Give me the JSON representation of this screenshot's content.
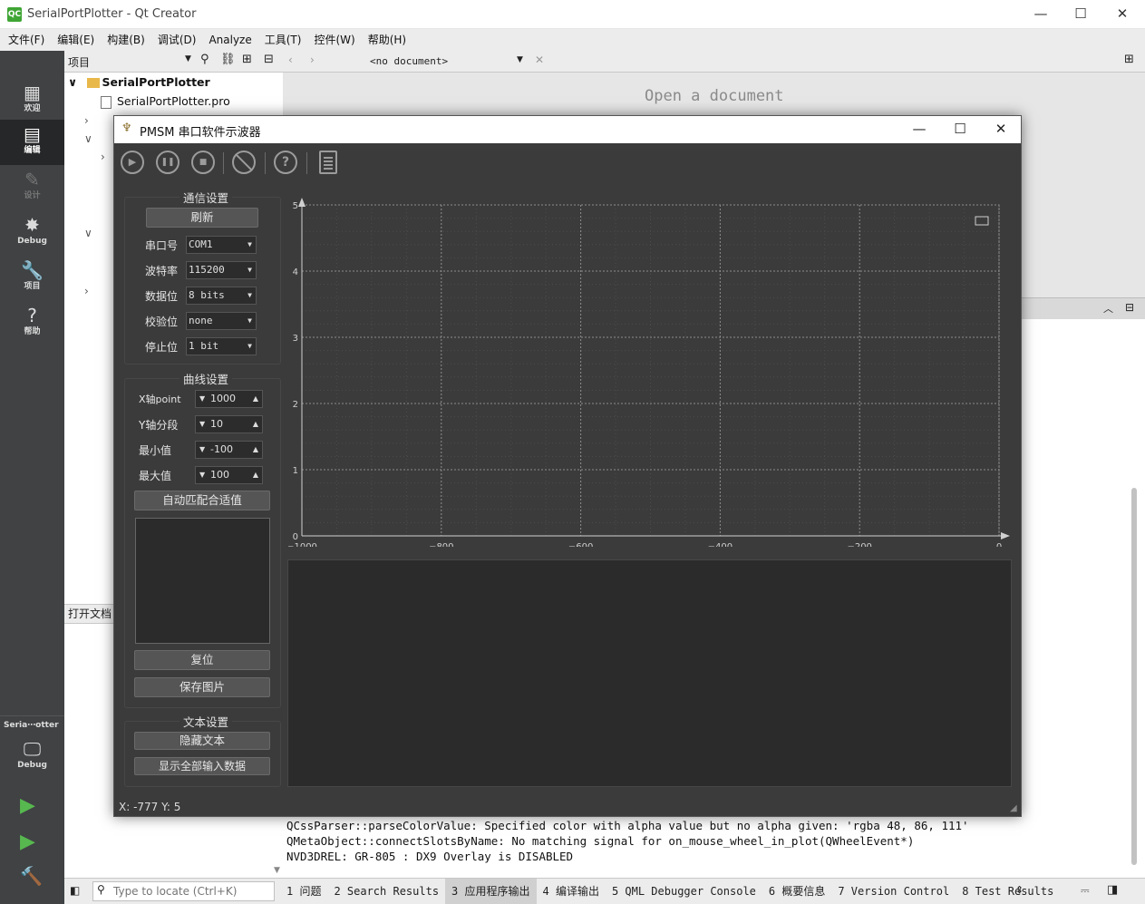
{
  "qtcreator": {
    "window_title": "SerialPortPlotter - Qt Creator",
    "logo_text": "QC",
    "minimize": "—",
    "maximize": "☐",
    "close": "✕",
    "menu": [
      "文件(F)",
      "编辑(E)",
      "构建(B)",
      "调试(D)",
      "Analyze",
      "工具(T)",
      "控件(W)",
      "帮助(H)"
    ],
    "modes": [
      {
        "icon": "▦",
        "label": "欢迎"
      },
      {
        "icon": "▤",
        "label": "编辑"
      },
      {
        "icon": "✎",
        "label": "设计"
      },
      {
        "icon": "✸",
        "label": "Debug"
      },
      {
        "icon": "🔧",
        "label": "项目"
      },
      {
        "icon": "?",
        "label": "帮助"
      }
    ],
    "kit": {
      "name": "Seria⋯otter",
      "icon": "🖵",
      "label": "Debug"
    },
    "run_buttons": [
      "▶",
      "▶",
      "🔨"
    ],
    "projects_header": "项目",
    "tree": [
      {
        "arrow": "∨",
        "name": "SerialPortPlotter"
      },
      {
        "name": "SerialPortPlotter.pro"
      }
    ],
    "open_docs_label": "打开文档",
    "editor_header": "<no document>",
    "open_document_text": "Open a document",
    "output_lines": [
      "QCssParser::parseColorValue: Specified color with alpha value but no alpha given: 'rgba 48, 86, 111'",
      "QMetaObject::connectSlotsByName: No matching signal for on_mouse_wheel_in_plot(QWheelEvent*)",
      "NVD3DREL: GR-805 : DX9 Overlay is DISABLED"
    ],
    "locator_placeholder": "Type to locate (Ctrl+K)",
    "output_tabs": [
      "1 问题",
      "2 Search Results",
      "3 应用程序输出",
      "4 编译输出",
      "5 QML Debugger Console",
      "6 概要信息",
      "7 Version Control",
      "8 Test Results"
    ],
    "active_output_tab": 2
  },
  "pmsm": {
    "title": "PMSM 串口软件示波器",
    "toolbar": [
      "▶",
      "❚❚",
      "■",
      "⃠",
      "?",
      "▤"
    ],
    "comm": {
      "title": "通信设置",
      "refresh": "刷新",
      "fields": [
        {
          "label": "串口号",
          "value": "COM1"
        },
        {
          "label": "波特率",
          "value": "115200"
        },
        {
          "label": "数据位",
          "value": "8 bits"
        },
        {
          "label": "校验位",
          "value": "none"
        },
        {
          "label": "停止位",
          "value": "1 bit"
        }
      ]
    },
    "curve": {
      "title": "曲线设置",
      "fields": [
        {
          "label": "X轴point",
          "value": "1000"
        },
        {
          "label": "Y轴分段",
          "value": "10"
        },
        {
          "label": "最小值",
          "value": "-100"
        },
        {
          "label": "最大值",
          "value": "100"
        }
      ],
      "autofit": "自动匹配合适值",
      "reset": "复位",
      "save_image": "保存图片"
    },
    "text": {
      "title": "文本设置",
      "hide_text": "隐藏文本",
      "show_all": "显示全部输入数据"
    },
    "status": "X: -777 Y: 5"
  },
  "chart_data": {
    "type": "line",
    "title": "",
    "xlabel": "",
    "ylabel": "",
    "xlim": [
      -1000,
      0
    ],
    "ylim": [
      0,
      5
    ],
    "x_ticks": [
      "−1000",
      "−800",
      "−600",
      "−400",
      "−200",
      "0"
    ],
    "y_ticks": [
      "0",
      "1",
      "2",
      "3",
      "4",
      "5"
    ],
    "grid": true,
    "series": []
  }
}
